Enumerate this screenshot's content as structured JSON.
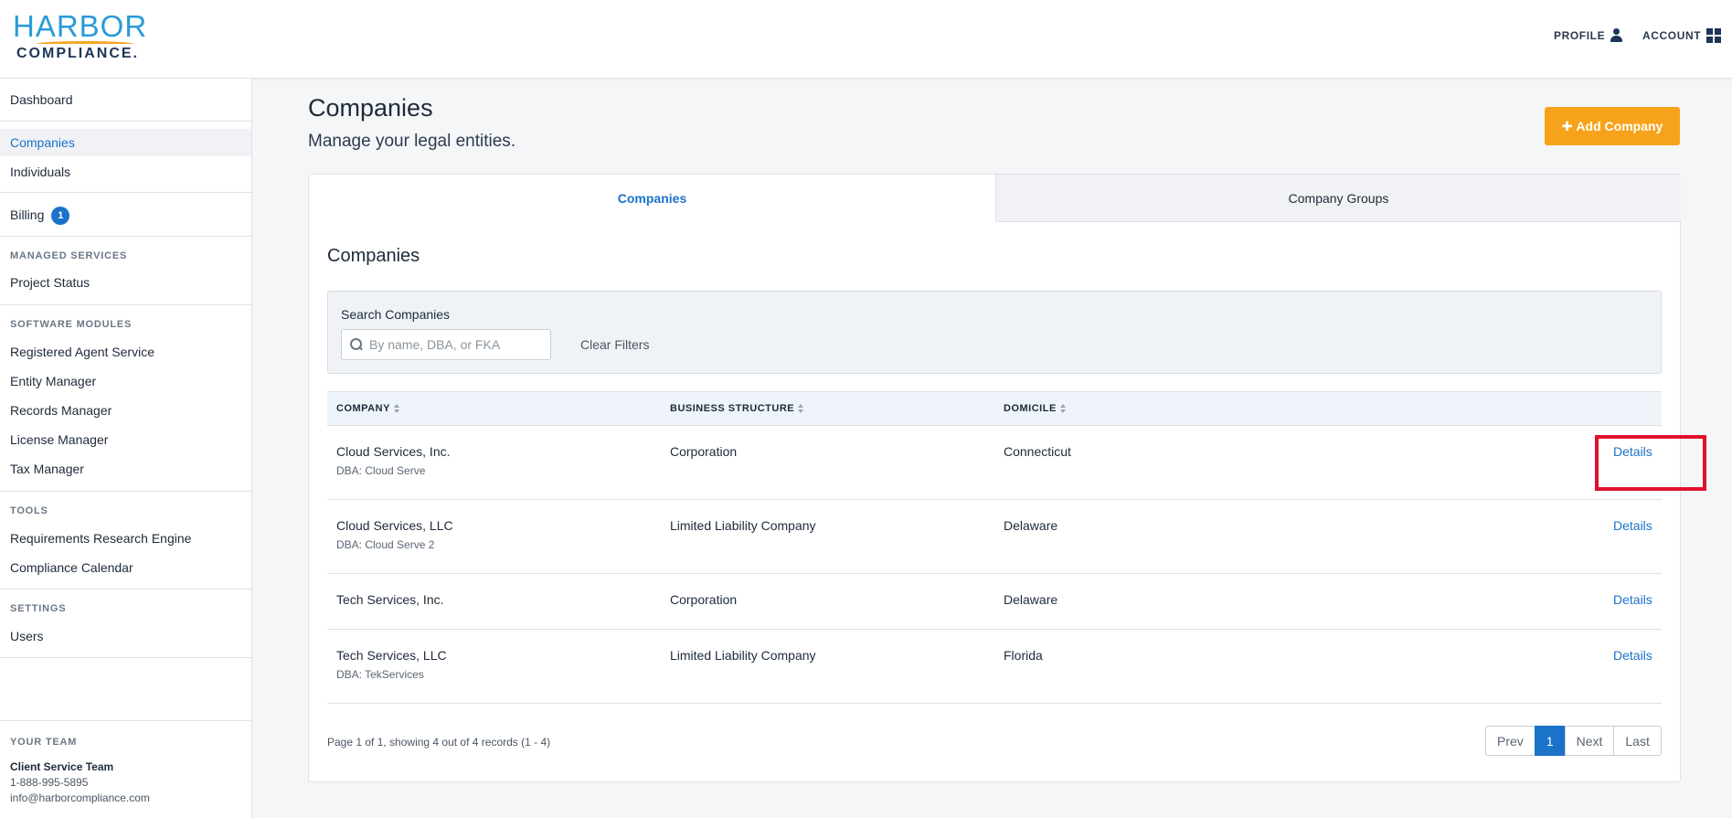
{
  "header": {
    "logo_top": "HARBOR",
    "logo_bottom": "COMPLIANCE.",
    "profile_label": "PROFILE",
    "account_label": "ACCOUNT"
  },
  "sidebar": {
    "dashboard": "Dashboard",
    "companies": "Companies",
    "individuals": "Individuals",
    "billing": "Billing",
    "billing_badge": "1",
    "managed_services_heading": "MANAGED SERVICES",
    "project_status": "Project Status",
    "software_modules_heading": "SOFTWARE MODULES",
    "registered_agent": "Registered Agent Service",
    "entity_manager": "Entity Manager",
    "records_manager": "Records Manager",
    "license_manager": "License Manager",
    "tax_manager": "Tax Manager",
    "tools_heading": "TOOLS",
    "research_engine": "Requirements Research Engine",
    "compliance_calendar": "Compliance Calendar",
    "settings_heading": "SETTINGS",
    "users": "Users",
    "team_heading": "YOUR TEAM",
    "team_name": "Client Service Team",
    "team_phone": "1-888-995-5895",
    "team_email": "info@harborcompliance.com"
  },
  "main": {
    "title": "Companies",
    "subtitle": "Manage your legal entities.",
    "add_button": "Add Company",
    "tabs": [
      {
        "label": "Companies",
        "active": true
      },
      {
        "label": "Company Groups",
        "active": false
      }
    ],
    "section_title": "Companies",
    "search_label": "Search Companies",
    "search_placeholder": "By name, DBA, or FKA",
    "search_value": "",
    "clear_filters": "Clear Filters",
    "columns": [
      "COMPANY",
      "BUSINESS STRUCTURE",
      "DOMICILE"
    ],
    "rows": [
      {
        "name": "Cloud Services, Inc.",
        "dba": "DBA: Cloud Serve",
        "structure": "Corporation",
        "domicile": "Connecticut",
        "action": "Details"
      },
      {
        "name": "Cloud Services, LLC",
        "dba": "DBA: Cloud Serve 2",
        "structure": "Limited Liability Company",
        "domicile": "Delaware",
        "action": "Details"
      },
      {
        "name": "Tech Services, Inc.",
        "dba": "",
        "structure": "Corporation",
        "domicile": "Delaware",
        "action": "Details"
      },
      {
        "name": "Tech Services, LLC",
        "dba": "DBA: TekServices",
        "structure": "Limited Liability Company",
        "domicile": "Florida",
        "action": "Details"
      }
    ],
    "page_info": "Page 1 of 1, showing 4 out of 4 records (1 - 4)",
    "pager": {
      "prev": "Prev",
      "current": "1",
      "next": "Next",
      "last": "Last"
    }
  },
  "colors": {
    "accent": "#1a73c8",
    "add_button": "#f7a21b",
    "highlight": "#e0112b"
  },
  "icons": [
    "user-icon",
    "grid-icon",
    "plus-icon",
    "search-icon",
    "sort-icon"
  ]
}
